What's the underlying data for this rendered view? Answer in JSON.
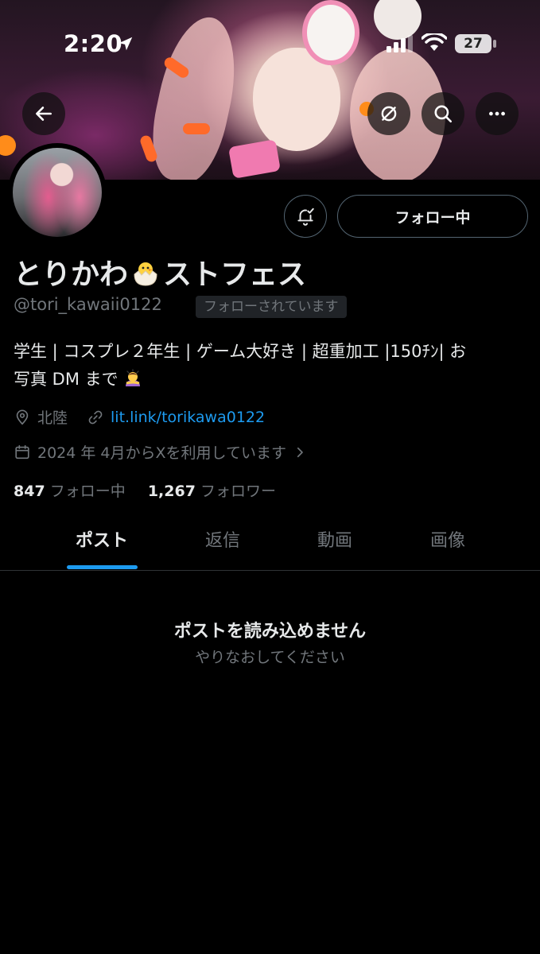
{
  "status_bar": {
    "time": "2:20",
    "battery": "27"
  },
  "header": {
    "back_icon": "arrow-left-icon",
    "grok_icon": "slash-circle-icon",
    "search_icon": "search-icon",
    "more_icon": "more-horizontal-icon"
  },
  "profile": {
    "display_name_part1": "とりかわ",
    "display_name_part2": "ストフェス",
    "handle": "@tori_kawaii0122",
    "follows_you": "フォローされています",
    "follow_button": "フォロー中",
    "bio_line1": "学生 | コスプレ２年生 | ゲーム大好き | 超重加工 |150ﾁﾝ| お",
    "bio_line2": "写真 DM まで",
    "location": "北陸",
    "website": "lit.link/torikawa0122",
    "joined": "2024 年 4月からXを利用しています",
    "following_count": "847",
    "following_label": "フォロー中",
    "followers_count": "1,267",
    "followers_label": "フォロワー"
  },
  "tabs": [
    {
      "label": "ポスト",
      "active": true
    },
    {
      "label": "返信",
      "active": false
    },
    {
      "label": "動画",
      "active": false
    },
    {
      "label": "画像",
      "active": false
    }
  ],
  "empty_state": {
    "title": "ポストを読み込めません",
    "subtitle": "やりなおしてください"
  },
  "colors": {
    "accent": "#1d9bf0",
    "background": "#000000",
    "muted": "#71767b"
  }
}
